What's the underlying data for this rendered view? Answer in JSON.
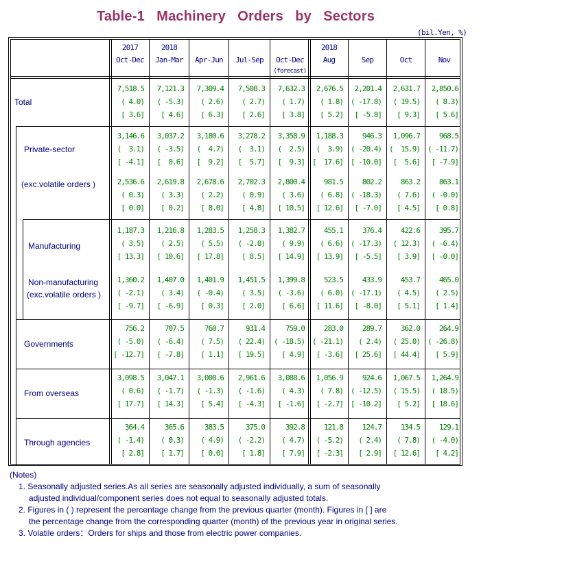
{
  "title": "Table-1   Machinery   Orders   by   Sectors",
  "unit": "(bil.Yen, %)",
  "columns": [
    {
      "year": "2017",
      "label": "Oct-Dec",
      "note": ""
    },
    {
      "year": "2018",
      "label": "Jan-Mar",
      "note": ""
    },
    {
      "year": "",
      "label": "Apr-Jun",
      "note": ""
    },
    {
      "year": "",
      "label": "Jul-Sep",
      "note": ""
    },
    {
      "year": "",
      "label": "Oct-Dec",
      "note": "(forecast)"
    },
    {
      "year": "2018",
      "label": "Aug",
      "note": ""
    },
    {
      "year": "",
      "label": "Sep",
      "note": ""
    },
    {
      "year": "",
      "label": "Oct",
      "note": ""
    },
    {
      "year": "",
      "label": "Nov",
      "note": ""
    }
  ],
  "rows": [
    {
      "label": "Total",
      "values": [
        [
          "7,518.5",
          "( 4.0)",
          "[ 3.6]"
        ],
        [
          "7,121.3",
          "( -5.3)",
          "[ 4.6]"
        ],
        [
          "7,309.4",
          "( 2.6)",
          "[ 6.3]"
        ],
        [
          "7,508.3",
          "( 2.7)",
          "[ 2.6]"
        ],
        [
          "7,632.3",
          "( 1.7)",
          "[ 3.8]"
        ],
        [
          "2,676.5",
          "( 1.8)",
          "[ 5.2]"
        ],
        [
          "2,201.4",
          "( -17.8)",
          "[ -5.8]"
        ],
        [
          "2,631.7",
          "( 19.5)",
          "[ 9.3]"
        ],
        [
          "2,850.6",
          "( 8.3)",
          "[ 5.6]"
        ]
      ]
    },
    {
      "label": "Private-sector",
      "values": [
        [
          "3,146.6",
          "(  3.1)",
          "[ -4.1]"
        ],
        [
          "3,037.2",
          "( -3.5)",
          "[  0.6]"
        ],
        [
          "3,180.6",
          "(  4.7)",
          "[  9.2]"
        ],
        [
          "3,278.2",
          "(  3.1)",
          "[  5.7]"
        ],
        [
          "3,358.9",
          "(  2.5)",
          "[  9.3]"
        ],
        [
          "1,188.3",
          "(  3.9)",
          "[  17.6]"
        ],
        [
          "946.3",
          "( -20.4)",
          "[ -10.0]"
        ],
        [
          "1,096.7",
          "(  15.9)",
          "[  5.6]"
        ],
        [
          "968.5",
          "( -11.7)",
          "[ -7.9]"
        ]
      ]
    },
    {
      "label": "(exc.volatile orders )",
      "values": [
        [
          "2,536.6",
          "( 0.3)",
          "[ 0.0]"
        ],
        [
          "2,619.8",
          "( 3.3)",
          "[ 0.2]"
        ],
        [
          "2,678.6",
          "( 2.2)",
          "[ 8.0]"
        ],
        [
          "2,702.3",
          "( 0.9)",
          "[ 4.8]"
        ],
        [
          "2,800.4",
          "( 3.6)",
          "[ 10.5]"
        ],
        [
          "981.5",
          "( 6.8)",
          "[ 12.6]"
        ],
        [
          "802.2",
          "( -18.3)",
          "[ -7.0]"
        ],
        [
          "863.2",
          "( 7.6)",
          "[ 4.5]"
        ],
        [
          "863.1",
          "( -0.0)",
          "[ 0.8]"
        ]
      ]
    },
    {
      "label": "Manufacturing",
      "values": [
        [
          "1,187.3",
          "( 3.5)",
          "[ 13.3]"
        ],
        [
          "1,216.8",
          "( 2.5)",
          "[ 10.6]"
        ],
        [
          "1,283.5",
          "( 5.5)",
          "[ 17.8]"
        ],
        [
          "1,258.3",
          "( -2.0)",
          "[ 8.5]"
        ],
        [
          "1,382.7",
          "( 9.9)",
          "[ 14.9]"
        ],
        [
          "455.1",
          "( 6.6)",
          "[ 13.9]"
        ],
        [
          "376.4",
          "( -17.3)",
          "[ -5.5]"
        ],
        [
          "422.6",
          "( 12.3)",
          "[ 3.9]"
        ],
        [
          "395.7",
          "( -6.4)",
          "[ -0.0]"
        ]
      ]
    },
    {
      "label": "Non-manufacturing",
      "label2": "(exc.volatile orders )",
      "values": [
        [
          "1,360.2",
          "( -2.1)",
          "[ -9.7]"
        ],
        [
          "1,407.0",
          "( 3.4)",
          "[ -6.9]"
        ],
        [
          "1,401.9",
          "( -0.4)",
          "[ 0.3]"
        ],
        [
          "1,451.5",
          "( 3.5)",
          "[ 2.0]"
        ],
        [
          "1,399.8",
          "( -3.6)",
          "[ 6.6]"
        ],
        [
          "523.5",
          "( 6.0)",
          "[ 11.6]"
        ],
        [
          "433.9",
          "( -17.1)",
          "[ -8.0]"
        ],
        [
          "453.7",
          "( 4.5)",
          "[ 5.1]"
        ],
        [
          "465.0",
          "( 2.5)",
          "[ 1.4]"
        ]
      ]
    },
    {
      "label": "Governments",
      "values": [
        [
          "756.2",
          "( -5.0)",
          "[ -12.7]"
        ],
        [
          "707.5",
          "( -6.4)",
          "[ -7.8]"
        ],
        [
          "760.7",
          "( 7.5)",
          "[ 1.1]"
        ],
        [
          "931.4",
          "( 22.4)",
          "[ 19.5]"
        ],
        [
          "759.0",
          "( -18.5)",
          "[ 4.9]"
        ],
        [
          "283.0",
          "( -21.1)",
          "[ -3.6]"
        ],
        [
          "289.7",
          "( 2.4)",
          "[ 25.6]"
        ],
        [
          "362.0",
          "( 25.0)",
          "[ 44.4]"
        ],
        [
          "264.9",
          "( -26.8)",
          "[ 5.9]"
        ]
      ]
    },
    {
      "label": "From overseas",
      "values": [
        [
          "3,098.5",
          "( 0.6)",
          "[ 17.7]"
        ],
        [
          "3,047.1",
          "( -1.7)",
          "[ 14.3]"
        ],
        [
          "3,008.6",
          "( -1.3)",
          "[ 5.4]"
        ],
        [
          "2,961.6",
          "( -1.6)",
          "[ -4.3]"
        ],
        [
          "3,088.6",
          "( 4.3)",
          "[ -1.6]"
        ],
        [
          "1,056.9",
          "( 7.8)",
          "[ -2.7]"
        ],
        [
          "924.6",
          "( -12.5)",
          "[ -10.2]"
        ],
        [
          "1,067.5",
          "( 15.5)",
          "[ 5.2]"
        ],
        [
          "1,264.9",
          "( 18.5)",
          "[ 18.6]"
        ]
      ]
    },
    {
      "label": "Through agencies",
      "values": [
        [
          "364.4",
          "( -1.4)",
          "[ 2.8]"
        ],
        [
          "365.6",
          "( 0.3)",
          "[ 1.7]"
        ],
        [
          "383.5",
          "( 4.9)",
          "[ 0.0]"
        ],
        [
          "375.0",
          "( -2.2)",
          "[ 1.8]"
        ],
        [
          "392.8",
          "( 4.7)",
          "[ 7.9]"
        ],
        [
          "121.8",
          "( -5.2)",
          "[ -2.3]"
        ],
        [
          "124.7",
          "( 2.4)",
          "[ 2.9]"
        ],
        [
          "134.5",
          "( 7.8)",
          "[ 12.6]"
        ],
        [
          "129.1",
          "( -4.0)",
          "[ 4.2]"
        ]
      ]
    }
  ],
  "notes": {
    "heading": "(Notes)",
    "lines": [
      "1. Seasonally adjusted series.As all series are seasonally adjusted individually, a sum of seasonally",
      "adjusted individual/component series does not equal to seasonally adjusted totals.",
      "2. Figures in ( ) represent the percentage change from the previous quarter (month). Figures in [ ] are",
      "the percentage change from the corresponding quarter (month) of the previous year in original series.",
      "3. Volatile orders：Orders for ships and those from electric power companies."
    ]
  }
}
